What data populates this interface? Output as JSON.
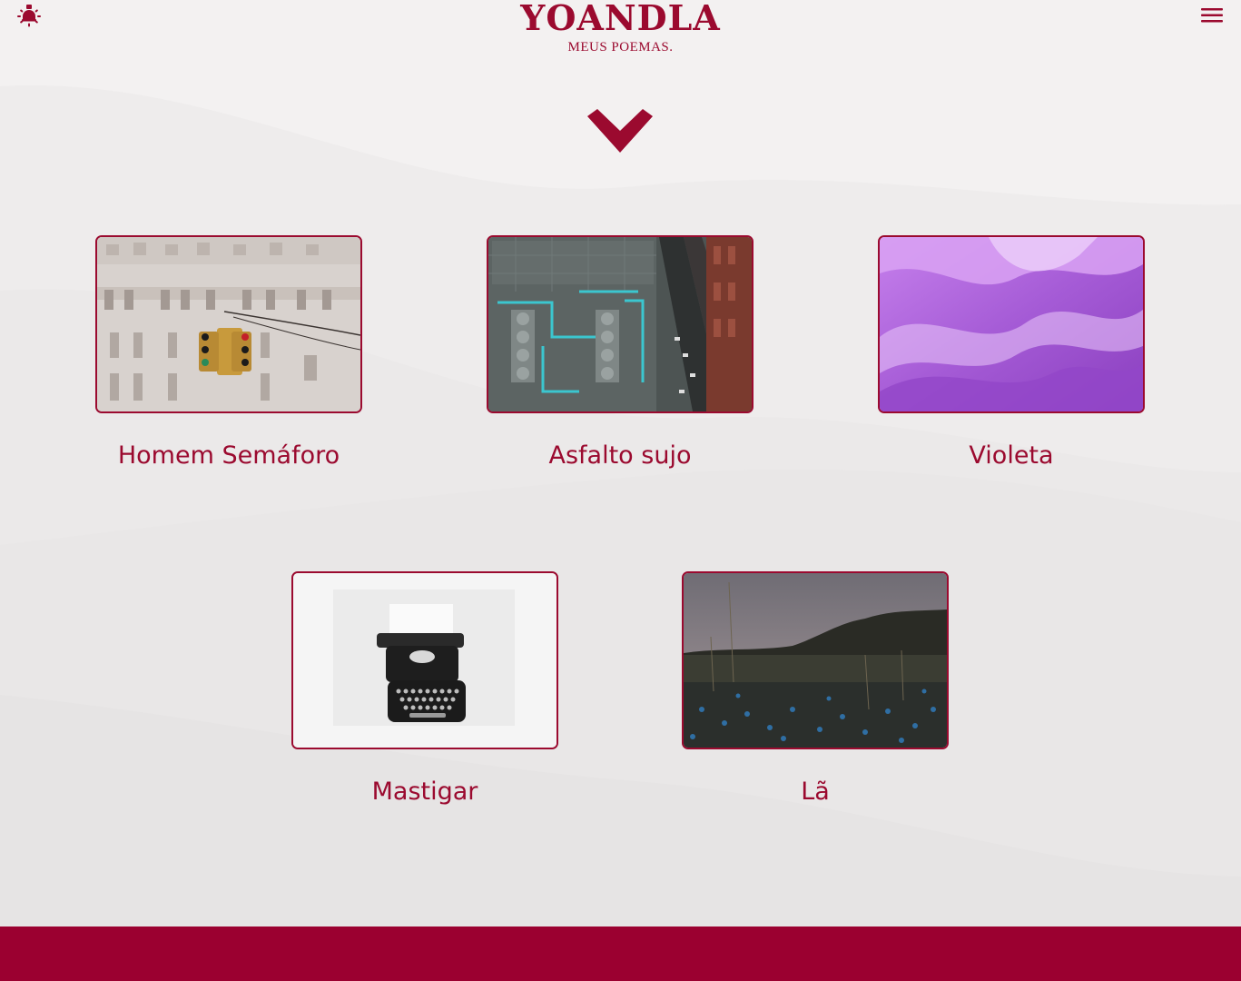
{
  "header": {
    "title": "YOANDLA",
    "subtitle": "MEUS POEMAS."
  },
  "icons": {
    "theme_toggle": "lightbulb-icon",
    "menu": "hamburger-menu-icon",
    "scroll_down": "chevron-down-icon"
  },
  "colors": {
    "accent": "#9b0a2f",
    "background": "#f3f1f1",
    "footer": "#9b0030"
  },
  "poems": [
    {
      "title": "Homem Semáforo",
      "image": "traffic-light-on-building"
    },
    {
      "title": "Asfalto sujo",
      "image": "aerial-rooftop-street"
    },
    {
      "title": "Violeta",
      "image": "violet-fabric"
    },
    {
      "title": "Mastigar",
      "image": "typewriter"
    },
    {
      "title": "Lã",
      "image": "field-at-dusk"
    }
  ]
}
